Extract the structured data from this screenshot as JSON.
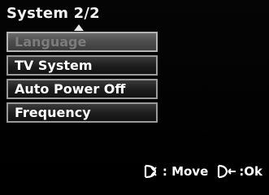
{
  "header": {
    "title": "System 2/2"
  },
  "menu": {
    "items": [
      {
        "label": "Language",
        "state": "disabled"
      },
      {
        "label": "TV System",
        "state": "normal"
      },
      {
        "label": "Auto Power Off",
        "state": "normal"
      },
      {
        "label": "Frequency",
        "state": "normal"
      }
    ]
  },
  "footer": {
    "move_label": ": Move",
    "ok_label": ":Ok",
    "move_icon": "dpad-updown-icon",
    "ok_icon": "dpad-right-icon"
  },
  "colors": {
    "background": "#000000",
    "text": "#ffffff",
    "disabled_text": "#7c7c7c",
    "item_border": "#9a9a9a"
  }
}
